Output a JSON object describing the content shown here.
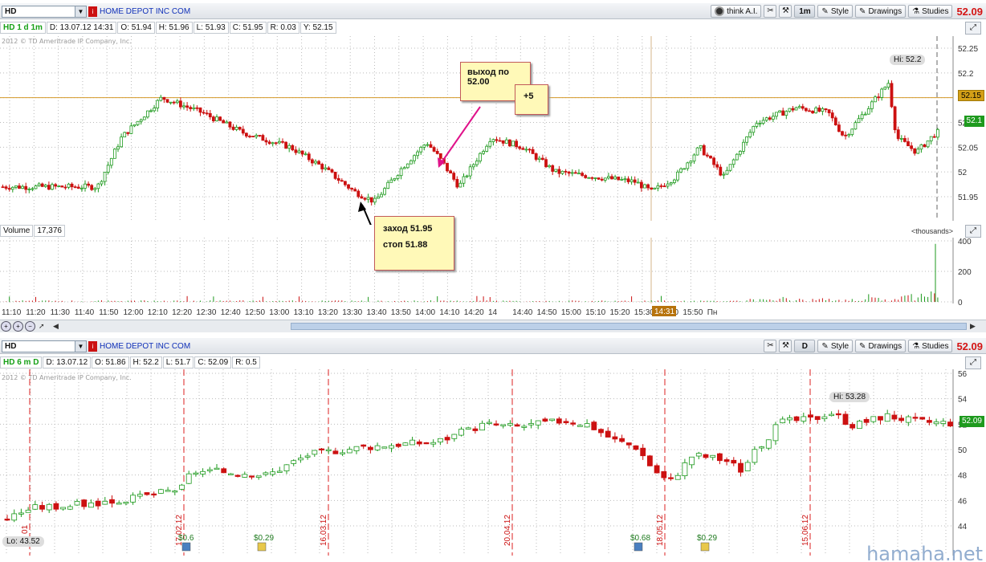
{
  "top_panel": {
    "symbol": "HD",
    "company": "HOME DEPOT INC COM",
    "last_price": "52.09",
    "toolbar": {
      "think_ai": "think A.I.",
      "aggregation": "1m",
      "style": "Style",
      "drawings": "Drawings",
      "studies": "Studies"
    },
    "info": {
      "label": "HD 1 d 1m",
      "date": "D: 13.07.12 14:31",
      "open": "O: 51.94",
      "high": "H: 51.96",
      "low": "L: 51.93",
      "close": "C: 51.95",
      "range": "R: 0.03",
      "y": "Y: 52.15"
    },
    "copyright": "2012 © TD Ameritrade IP Company, Inc.",
    "price_axis": [
      "52.25",
      "52.2",
      "52.15",
      "52.1",
      "52.05",
      "52",
      "51.95"
    ],
    "price_tags": {
      "horizontal_line": "52.15",
      "last": "52.1"
    },
    "hi_label": "Hi: 52.2",
    "volume": {
      "label": "Volume",
      "value": "17,376",
      "units": "<thousands>",
      "axis": [
        "400",
        "200",
        "0"
      ]
    },
    "time_axis": [
      "11:10",
      "11:20",
      "11:30",
      "11:40",
      "11:50",
      "12:00",
      "12:10",
      "12:20",
      "12:30",
      "12:40",
      "12:50",
      "13:00",
      "13:10",
      "13:20",
      "13:30",
      "13:40",
      "13:50",
      "14:00",
      "14:10",
      "14:20",
      "14",
      "14:40",
      "14:50",
      "15:00",
      "15:10",
      "15:20",
      "15:30",
      "15:40",
      "15:50",
      "Пн"
    ],
    "cursor_time": "14:31",
    "annotations": {
      "exit": {
        "line1": "выход по",
        "line2": "52.00"
      },
      "profit": "+5",
      "entry": {
        "line1": "заход 51.95",
        "line2": "стоп 51.88"
      }
    }
  },
  "bottom_panel": {
    "symbol": "HD",
    "company": "HOME DEPOT INC COM",
    "last_price": "52.09",
    "toolbar": {
      "aggregation": "D",
      "style": "Style",
      "drawings": "Drawings",
      "studies": "Studies"
    },
    "info": {
      "label": "HD 6 m D",
      "date": "D: 13.07.12",
      "open": "O: 51.86",
      "high": "H: 52.2",
      "low": "L: 51.7",
      "close": "C: 52.09",
      "range": "R: 0.5"
    },
    "copyright": "2012 © TD Ameritrade IP Company, Inc.",
    "price_axis": [
      "56",
      "54",
      "52",
      "50",
      "48",
      "46",
      "44"
    ],
    "price_tag": "52.09",
    "hi_label": "Hi: 53.28",
    "lo_label": "Lo: 43.52",
    "date_markers": [
      "01",
      "17.02.12",
      "16.03.12",
      "20.04.12",
      "18.05.12",
      "15.06.12"
    ],
    "dividend_labels": [
      "$0.6",
      "$0.29",
      "$0.68",
      "$0.29"
    ]
  },
  "watermark": "hamaha.net"
}
